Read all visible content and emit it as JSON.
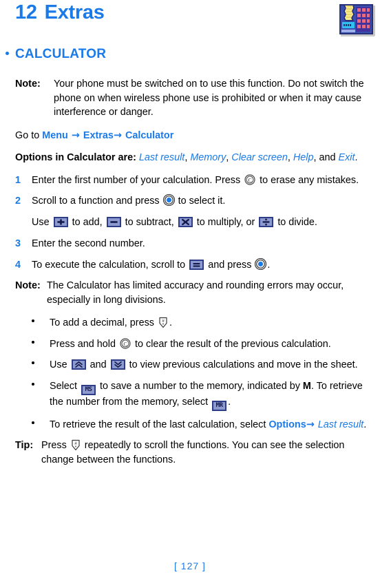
{
  "header": {
    "chapter_number": "12",
    "chapter_title": "Extras",
    "icon_name": "calculator-icon"
  },
  "section": {
    "title": "CALCULATOR"
  },
  "note1": {
    "label": "Note:",
    "text": "Your phone must be switched on to use this function. Do not switch the phone on when wireless phone use is prohibited or when it may cause interference or danger."
  },
  "goto": {
    "prefix": "Go to ",
    "menu": "Menu",
    "arrow1": " → ",
    "extras": "Extras",
    "arrow2": "→ ",
    "calculator": "Calculator"
  },
  "options_line": {
    "prefix": "Options in Calculator are:",
    "items": [
      "Last result",
      "Memory",
      "Clear screen",
      "Help",
      "Exit"
    ],
    "conjunction": "and",
    "trailing": "."
  },
  "steps": [
    {
      "num": "1",
      "text_before": "Enter the first number of your calculation. Press",
      "icon": "clear-key-icon",
      "text_after": "to erase any mistakes."
    },
    {
      "num": "2",
      "text_before": "Scroll to a function and press",
      "icon": "scroll-select-key-icon",
      "text_after": "to select it."
    },
    {
      "num": "3",
      "text_before": "Enter the second number.",
      "icon": "",
      "text_after": ""
    },
    {
      "num": "4",
      "text_before": "To execute the calculation, scroll to",
      "icon": "equals-key-icon",
      "text_after": "and press",
      "icon2": "scroll-select-key-icon",
      "text_end": "."
    }
  ],
  "operators_line": {
    "use": "Use",
    "plus_label": "+",
    "to_add": "to add,",
    "minus_label": "−",
    "to_subtract": "to subtract,",
    "times_label": "✕",
    "to_multiply": "to multiply, or",
    "divide_label": "÷",
    "to_divide": "to divide."
  },
  "note2": {
    "label": "Note:",
    "text": "The Calculator has limited accuracy and rounding errors may occur, especially in long divisions."
  },
  "bullets": [
    {
      "text_before": "To add a decimal, press",
      "icon": "hash-key-icon",
      "text_after": "."
    },
    {
      "text_before": "Press and hold",
      "icon": "clear-key-icon",
      "text_after": "to clear the result of the previous calculation."
    },
    {
      "text_before": "Use",
      "icon": "scroll-up-key-icon",
      "text_mid": "and",
      "icon2": "scroll-down-key-icon",
      "text_after": "to view previous calculations and move in the sheet."
    },
    {
      "text_before": "Select",
      "icon": "memory-save-key-icon",
      "icon_label": "MS",
      "text_mid": "to save a number to the memory, indicated by",
      "bold_letter": "M",
      "text_mid2": ". To retrieve the number from the memory, select",
      "icon2": "memory-recall-key-icon",
      "icon2_label": "MR",
      "text_after": "."
    },
    {
      "text_before": "To retrieve the result of the last calculation, select",
      "options_label": "Options",
      "arrow": "→ ",
      "last_result": "Last result",
      "text_after": "."
    }
  ],
  "tip": {
    "label": "Tip:",
    "text_before": "Press",
    "icon": "hash-key-icon",
    "text_after": "repeatedly to scroll the functions. You can see the selection change between the functions."
  },
  "footer": {
    "page_marker": "[ 127 ]"
  },
  "colors": {
    "accent_blue": "#1a7ae8",
    "key_border": "#2c3c86",
    "key_fill": "#8d9ad0",
    "icon_red": "#e05a6e",
    "icon_yellow": "#f2e27a",
    "icon_cyan": "#2ab8e8"
  }
}
